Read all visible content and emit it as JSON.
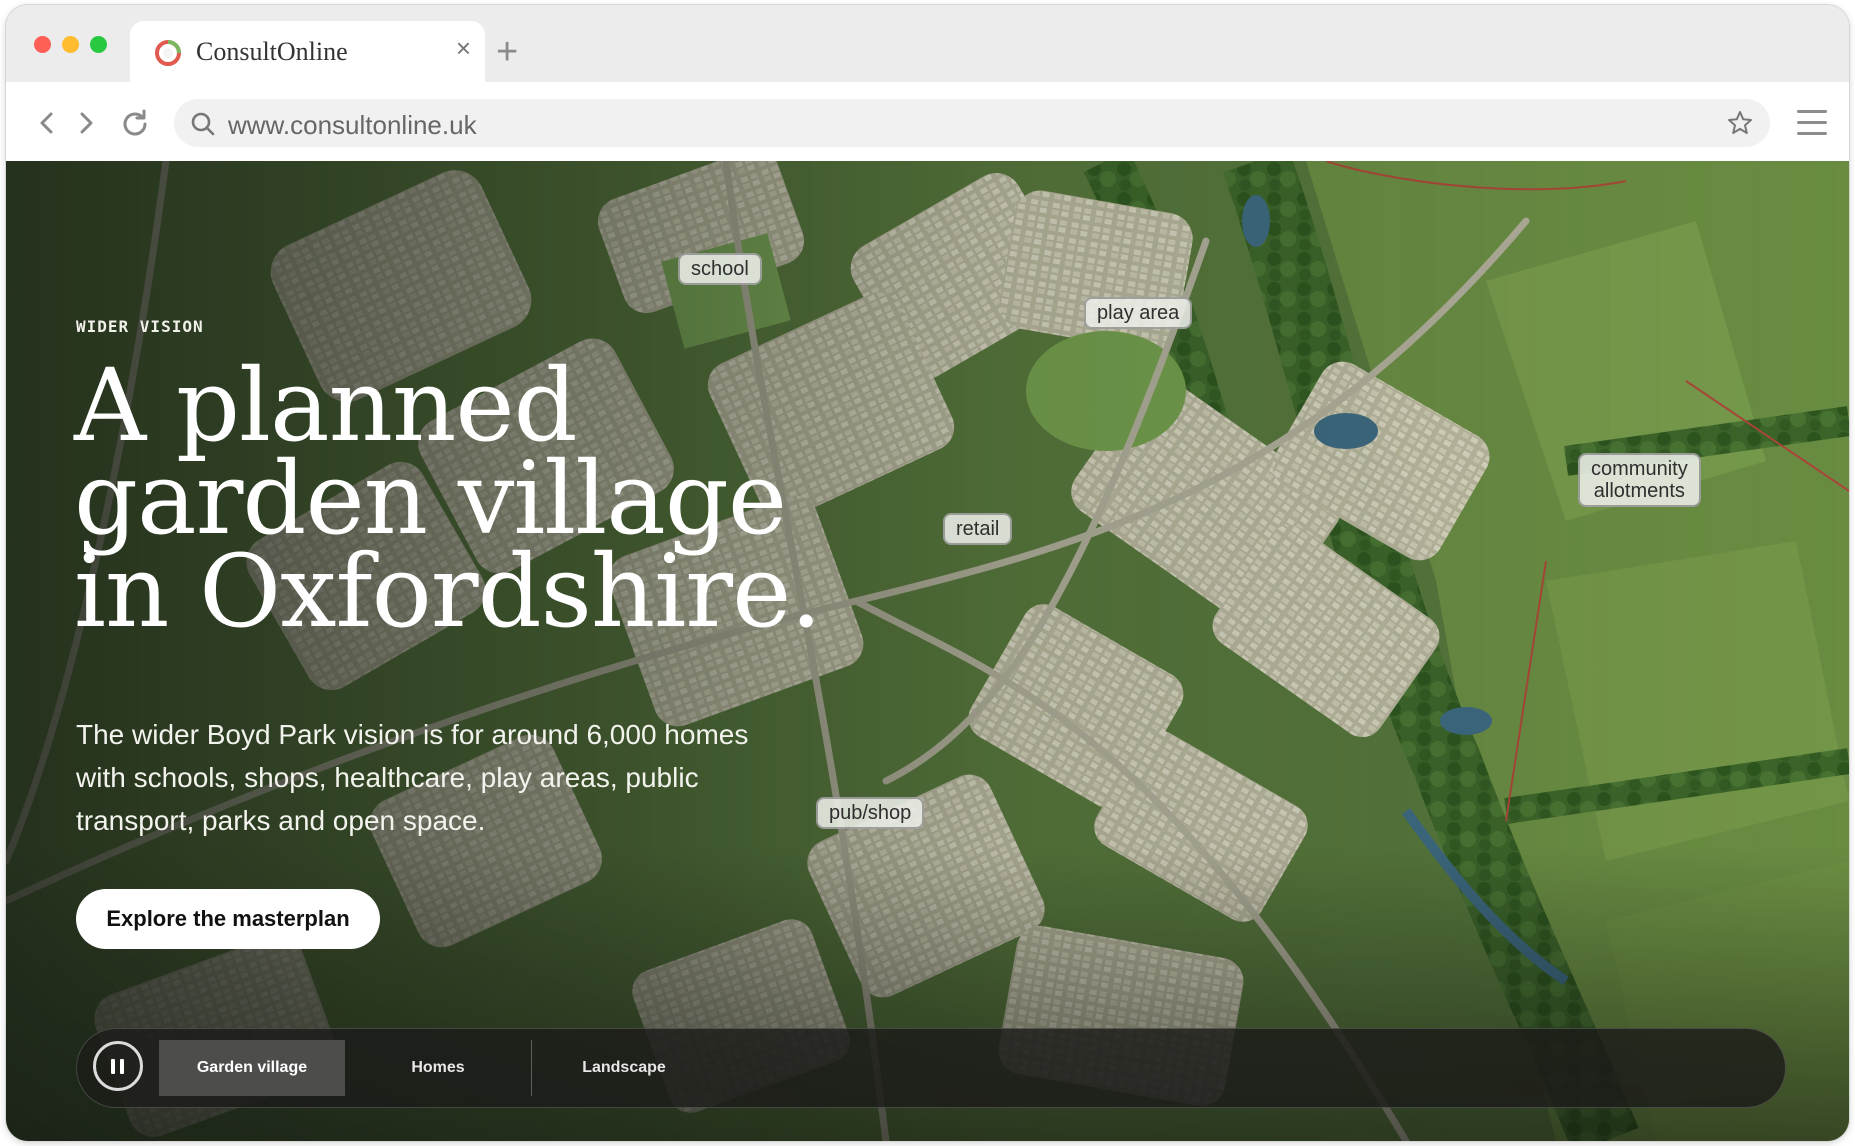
{
  "browser": {
    "tab_title": "ConsultOnline",
    "url": "www.consultonline.uk",
    "colors": {
      "favicon_ring": "#d9534f",
      "favicon_inner": "#6ab04c"
    }
  },
  "hero": {
    "eyebrow": "WIDER VISION",
    "headline": [
      "A planned",
      "garden village",
      "in Oxfordshire."
    ],
    "description_lines": [
      "The wider Boyd Park vision is for around 6,000 homes",
      "with schools, shops, healthcare, play areas, public",
      "transport, parks and open space."
    ],
    "cta_label": "Explore the masterplan"
  },
  "map_labels": {
    "school": "school",
    "play_area": "play area",
    "community_allotments": [
      "community",
      "allotments"
    ],
    "retail": "retail",
    "pub_shop": "pub/shop"
  },
  "slides": {
    "tabs": [
      {
        "label": "Garden village",
        "active": true
      },
      {
        "label": "Homes",
        "active": false
      },
      {
        "label": "Landscape",
        "active": false
      }
    ]
  },
  "icons": [
    "favicon-icon",
    "close-icon",
    "new-tab-icon",
    "back-icon",
    "forward-icon",
    "reload-icon",
    "search-icon",
    "bookmark-star-icon",
    "menu-icon",
    "pause-icon"
  ]
}
